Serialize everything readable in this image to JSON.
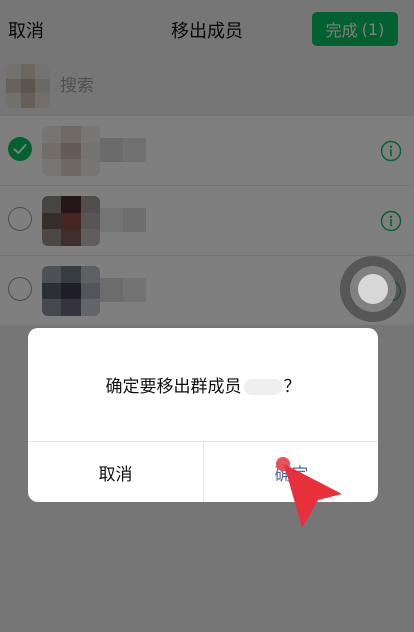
{
  "header": {
    "cancel_label": "取消",
    "title": "移出成员",
    "done_label": "完成",
    "done_count": "(1)"
  },
  "search": {
    "placeholder": "搜索"
  },
  "members": [
    {
      "selected": true
    },
    {
      "selected": false
    },
    {
      "selected": false
    }
  ],
  "dialog": {
    "message": "确定要移出群成员",
    "message_suffix": "？",
    "cancel_label": "取消",
    "confirm_label": "确定"
  },
  "colors": {
    "accent_green": "#07c160",
    "confirm_blue": "#576b95",
    "pointer_red": "#e8303d"
  }
}
